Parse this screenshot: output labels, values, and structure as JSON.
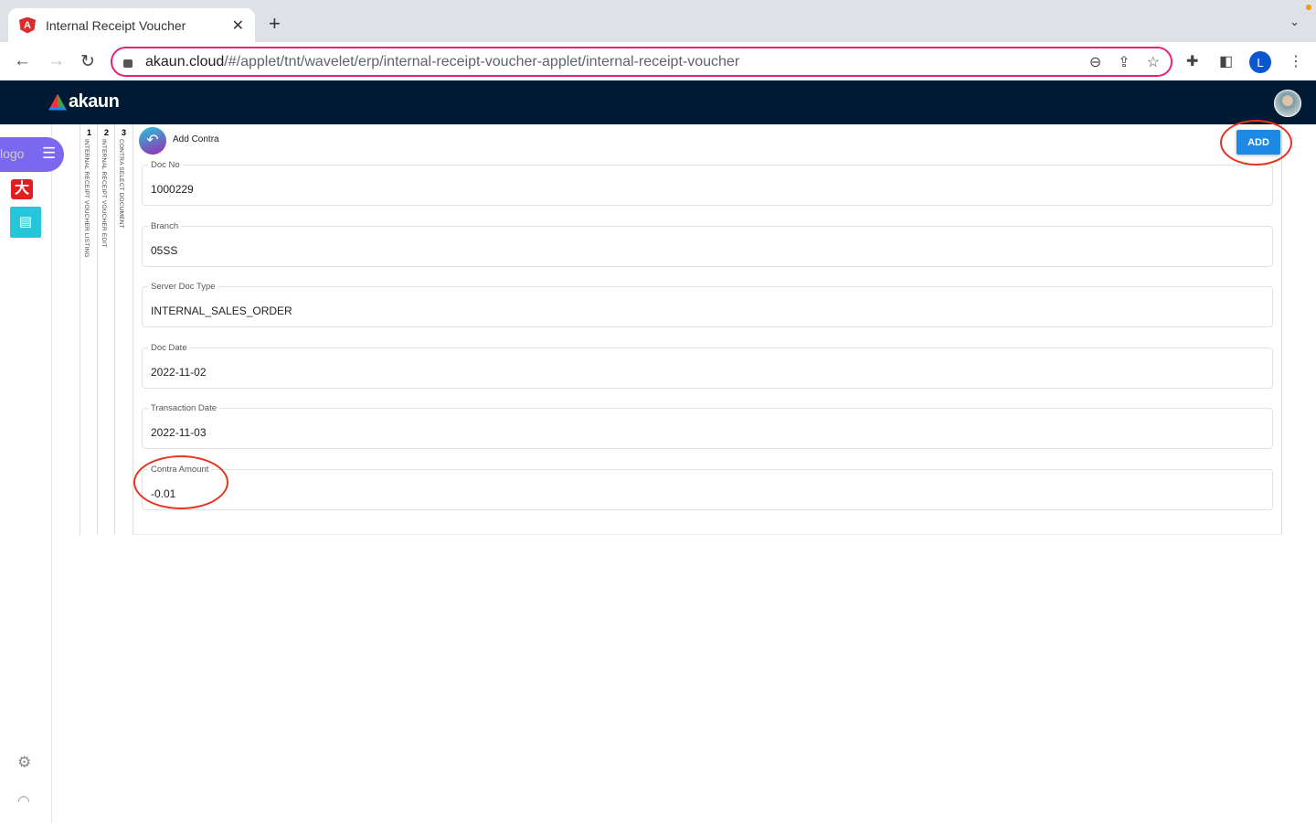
{
  "browser": {
    "tab_title": "Internal Receipt Voucher",
    "url_host": "akaun.cloud",
    "url_path": "/#/applet/tnt/wavelet/erp/internal-receipt-voucher-applet/internal-receipt-voucher",
    "profile_initial": "L"
  },
  "app": {
    "brand": "akaun",
    "logo_alt": "logo"
  },
  "steps": [
    {
      "number": "1",
      "label": "INTERNAL RECEIPT VOUCHER LISTING"
    },
    {
      "number": "2",
      "label": "INTERNAL RECEIPT VOUCHER EDIT"
    },
    {
      "number": "3",
      "label": "CONTRA SELECT DOCUMENT"
    }
  ],
  "page": {
    "title": "Add Contra",
    "add_label": "ADD",
    "fields": [
      {
        "label": "Doc No",
        "value": "1000229"
      },
      {
        "label": "Branch",
        "value": "05SS"
      },
      {
        "label": "Server Doc Type",
        "value": "INTERNAL_SALES_ORDER"
      },
      {
        "label": "Doc Date",
        "value": "2022-11-02"
      },
      {
        "label": "Transaction Date",
        "value": "2022-11-03"
      },
      {
        "label": "Contra Amount",
        "value": "-0.01"
      }
    ]
  },
  "colors": {
    "header": "#001a33",
    "accent": "#1e88e5",
    "annotation": "#e8321e"
  }
}
